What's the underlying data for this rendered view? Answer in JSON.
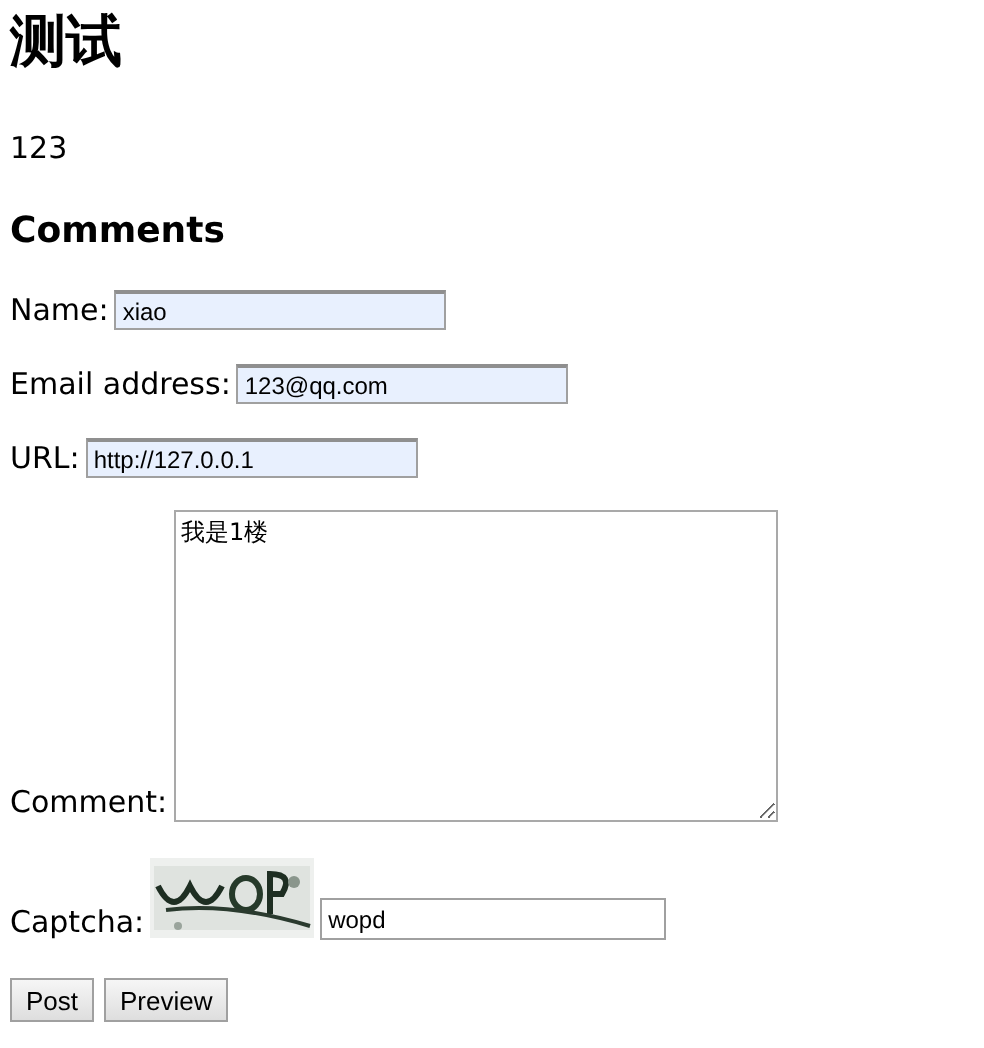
{
  "title": "测试",
  "body": "123",
  "comments_heading": "Comments",
  "fields": [
    {
      "kind": "text",
      "label": "Name:",
      "value": "xiao",
      "autofilled": true
    },
    {
      "kind": "text",
      "label": "Email address:",
      "value": "123@qq.com",
      "autofilled": true
    },
    {
      "kind": "text",
      "label": "URL:",
      "value": "http://127.0.0.1",
      "autofilled": true
    },
    {
      "kind": "textarea",
      "label": "Comment:",
      "value": "我是1楼",
      "autofilled": false
    },
    {
      "kind": "captcha",
      "label": "Captcha:",
      "value": "wopd",
      "autofilled": false
    }
  ],
  "buttons": [
    "Post",
    "Preview"
  ]
}
